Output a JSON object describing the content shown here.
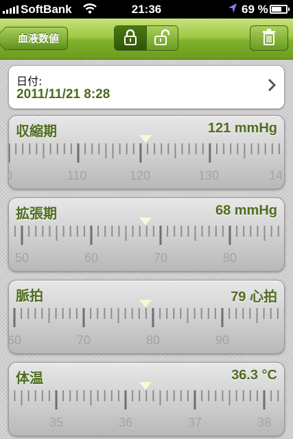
{
  "status_bar": {
    "carrier": "SoftBank",
    "time": "21:36",
    "battery_text": "69 %",
    "battery_level": 0.69
  },
  "nav": {
    "back_label": "血液数値",
    "lock_state": "locked"
  },
  "date_field": {
    "label": "日付:",
    "value": "2011/11/21 8:28"
  },
  "rulers": [
    {
      "name": "収縮期",
      "value_text": "121 mmHg",
      "value": 121,
      "labels": [
        "0",
        "110",
        "120",
        "130",
        "14"
      ]
    },
    {
      "name": "拡張期",
      "value_text": "68 mmHg",
      "value": 68,
      "labels": [
        "50",
        "60",
        "70",
        "80"
      ]
    },
    {
      "name": "脈拍",
      "value_text": "79 心拍",
      "value": 79,
      "labels": [
        "60",
        "70",
        "80",
        "90"
      ]
    },
    {
      "name": "体温",
      "value_text": "36.3 °C",
      "value": 36.3,
      "labels": [
        "35",
        "36",
        "37",
        "38"
      ]
    }
  ],
  "colors": {
    "accent_green": "#7fb02a",
    "value_green": "#4f6c1e",
    "date_green": "#4b6a1b"
  },
  "icons": {
    "lock_closed": "lock-closed-icon",
    "lock_open": "lock-open-icon",
    "trash": "trash-icon",
    "chevron": "chevron-right-icon",
    "wifi": "wifi-icon",
    "location": "location-arrow-icon",
    "battery": "battery-icon"
  }
}
